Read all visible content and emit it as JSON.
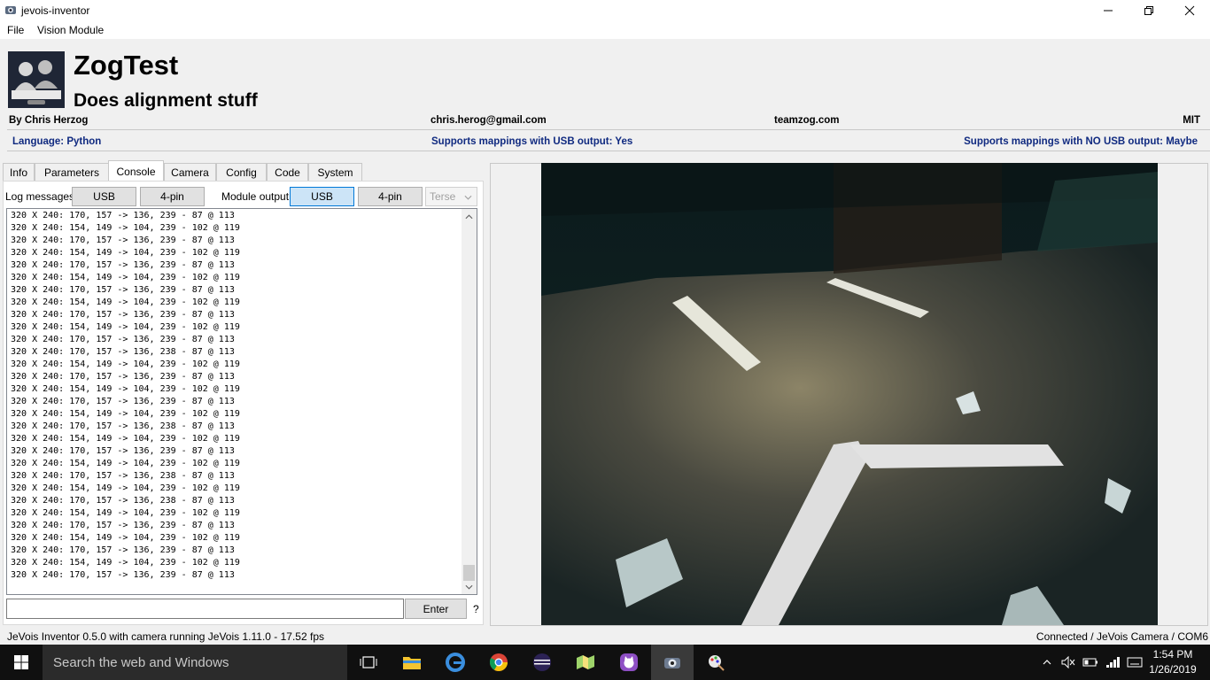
{
  "window": {
    "title": "jevois-inventor"
  },
  "menu": {
    "items": [
      "File",
      "Vision Module"
    ]
  },
  "module": {
    "name": "ZogTest",
    "description": "Does alignment stuff",
    "author": "By Chris Herzog",
    "email": "chris.herog@gmail.com",
    "website": "teamzog.com",
    "license": "MIT",
    "language": "Language: Python",
    "usb_support": "Supports mappings with USB output: Yes",
    "nousb_support": "Supports mappings with NO USB output: Maybe",
    "logo_text": "JOLIET CYBORGS"
  },
  "tabs": [
    "Info",
    "Parameters",
    "Console",
    "Camera",
    "Config",
    "Code",
    "System"
  ],
  "active_tab": "Console",
  "console": {
    "log_label": "Log messages:",
    "log_usb": "USB",
    "log_4pin": "4-pin",
    "module_output_label": "Module output:",
    "out_usb": "USB",
    "out_4pin": "4-pin",
    "verbosity": "Terse",
    "enter_label": "Enter",
    "help": "?",
    "lines": [
      "320 X 240: 170, 157 -> 136, 239 - 87 @ 113",
      "320 X 240: 154, 149 -> 104, 239 - 102 @ 119",
      "320 X 240: 170, 157 -> 136, 239 - 87 @ 113",
      "320 X 240: 154, 149 -> 104, 239 - 102 @ 119",
      "320 X 240: 170, 157 -> 136, 239 - 87 @ 113",
      "320 X 240: 154, 149 -> 104, 239 - 102 @ 119",
      "320 X 240: 170, 157 -> 136, 239 - 87 @ 113",
      "320 X 240: 154, 149 -> 104, 239 - 102 @ 119",
      "320 X 240: 170, 157 -> 136, 239 - 87 @ 113",
      "320 X 240: 154, 149 -> 104, 239 - 102 @ 119",
      "320 X 240: 170, 157 -> 136, 239 - 87 @ 113",
      "320 X 240: 170, 157 -> 136, 238 - 87 @ 113",
      "320 X 240: 154, 149 -> 104, 239 - 102 @ 119",
      "320 X 240: 170, 157 -> 136, 239 - 87 @ 113",
      "320 X 240: 154, 149 -> 104, 239 - 102 @ 119",
      "320 X 240: 170, 157 -> 136, 239 - 87 @ 113",
      "320 X 240: 154, 149 -> 104, 239 - 102 @ 119",
      "320 X 240: 170, 157 -> 136, 238 - 87 @ 113",
      "320 X 240: 154, 149 -> 104, 239 - 102 @ 119",
      "320 X 240: 170, 157 -> 136, 239 - 87 @ 113",
      "320 X 240: 154, 149 -> 104, 239 - 102 @ 119",
      "320 X 240: 170, 157 -> 136, 238 - 87 @ 113",
      "320 X 240: 154, 149 -> 104, 239 - 102 @ 119",
      "320 X 240: 170, 157 -> 136, 238 - 87 @ 113",
      "320 X 240: 154, 149 -> 104, 239 - 102 @ 119",
      "320 X 240: 170, 157 -> 136, 239 - 87 @ 113",
      "320 X 240: 154, 149 -> 104, 239 - 102 @ 119",
      "320 X 240: 170, 157 -> 136, 239 - 87 @ 113",
      "320 X 240: 154, 149 -> 104, 239 - 102 @ 119",
      "320 X 240: 170, 157 -> 136, 239 - 87 @ 113"
    ]
  },
  "status": {
    "left": "JeVois Inventor 0.5.0 with camera running JeVois 1.11.0 - 17.52 fps",
    "right": "Connected / JeVois Camera / COM6"
  },
  "taskbar": {
    "search_placeholder": "Search the web and Windows",
    "time": "1:54 PM",
    "date": "1/26/2019"
  },
  "colors": {
    "accent": "#0078d7",
    "info_blue": "#102a80",
    "taskbar": "#101010"
  }
}
